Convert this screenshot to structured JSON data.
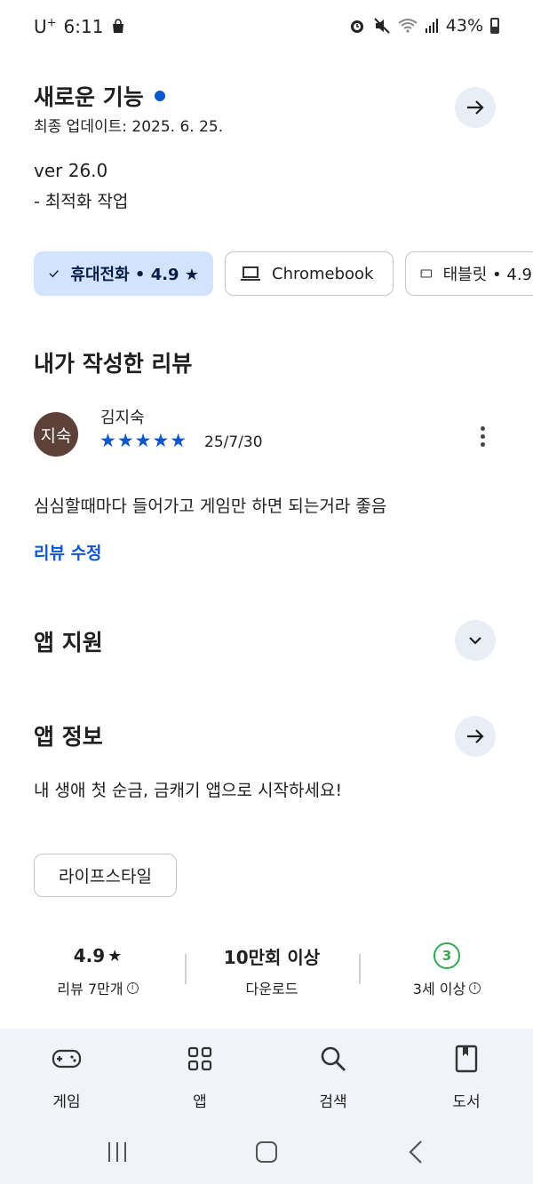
{
  "status_bar": {
    "carrier": "U",
    "carrier_sup": "+",
    "time": "6:11",
    "battery": "43%"
  },
  "whats_new": {
    "title": "새로운 기능",
    "updated": "최종 업데이트: 2025. 6. 25.",
    "version": "ver 26.0",
    "note": "- 최적화 작업"
  },
  "device_chips": [
    {
      "label": "휴대전화 • 4.9 ★",
      "selected": true,
      "icon": "check-icon"
    },
    {
      "label": "Chromebook",
      "selected": false,
      "icon": "laptop-icon"
    },
    {
      "label": "태블릿 • 4.9",
      "selected": false,
      "icon": "tablet-icon"
    }
  ],
  "my_review": {
    "title": "내가 작성한 리뷰",
    "avatar_text": "지숙",
    "reviewer": "김지숙",
    "rating": 5,
    "stars": "★★★★★",
    "date": "25/7/30",
    "text": "심심할때마다 들어가고 게임만 하면 되는거라 좋음",
    "edit_label": "리뷰 수정"
  },
  "app_support": {
    "title": "앱 지원"
  },
  "app_info": {
    "title": "앱 정보",
    "description": "내 생애 첫 순금, 금캐기 앱으로 시작하세요!"
  },
  "category": "라이프스타일",
  "stats": {
    "rating_value": "4.9",
    "rating_star": "★",
    "rating_label": "리뷰 7만개",
    "downloads_value": "10만회 이상",
    "downloads_label": "다운로드",
    "age_badge": "3",
    "age_label": "3세 이상"
  },
  "bottom_nav": [
    {
      "label": "게임",
      "icon": "gamepad-icon"
    },
    {
      "label": "앱",
      "icon": "apps-grid-icon"
    },
    {
      "label": "검색",
      "icon": "search-icon"
    },
    {
      "label": "도서",
      "icon": "book-icon"
    }
  ],
  "colors": {
    "accent": "#0b57d0",
    "chip_selected_bg": "#d3e3fd",
    "avatar_bg": "#5d4037",
    "age_badge": "#34a853",
    "nav_bg": "#f0f3f8"
  }
}
